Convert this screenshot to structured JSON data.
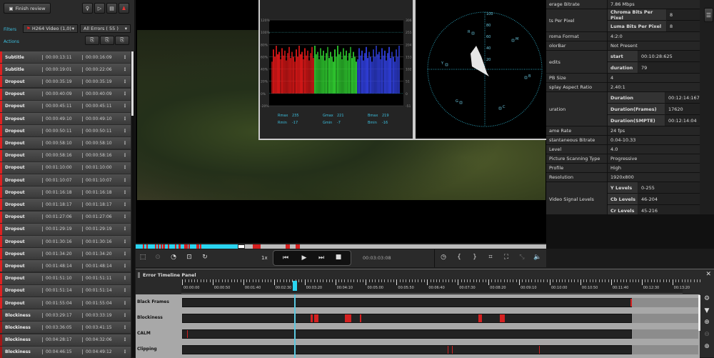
{
  "left_panel": {
    "finish_review_label": "Finish review",
    "filters_label": "Filters",
    "actions_label": "Actions",
    "track_select": "H264 Video (1,0)",
    "error_select": "All Errors ( 55 )",
    "icons": [
      "lightbulb-icon",
      "export-icon",
      "report-icon",
      "user-alert-icon"
    ],
    "errors": [
      {
        "type": "Subtitle",
        "start": "00:00:13:11",
        "end": "00:00:16:09"
      },
      {
        "type": "Subtitle",
        "start": "00:00:19:01",
        "end": "00:00:22:06"
      },
      {
        "type": "Dropout",
        "start": "00:00:35:19",
        "end": "00:00:35:19"
      },
      {
        "type": "Dropout",
        "start": "00:00:40:09",
        "end": "00:00:40:09"
      },
      {
        "type": "Dropout",
        "start": "00:00:45:11",
        "end": "00:00:45:11"
      },
      {
        "type": "Dropout",
        "start": "00:00:49:10",
        "end": "00:00:49:10"
      },
      {
        "type": "Dropout",
        "start": "00:00:50:11",
        "end": "00:00:50:11"
      },
      {
        "type": "Dropout",
        "start": "00:00:58:10",
        "end": "00:00:58:10"
      },
      {
        "type": "Dropout",
        "start": "00:00:58:16",
        "end": "00:00:58:16"
      },
      {
        "type": "Dropout",
        "start": "00:01:10:00",
        "end": "00:01:10:00"
      },
      {
        "type": "Dropout",
        "start": "00:01:10:07",
        "end": "00:01:10:07"
      },
      {
        "type": "Dropout",
        "start": "00:01:16:18",
        "end": "00:01:16:18"
      },
      {
        "type": "Dropout",
        "start": "00:01:18:17",
        "end": "00:01:18:17"
      },
      {
        "type": "Dropout",
        "start": "00:01:27:06",
        "end": "00:01:27:06"
      },
      {
        "type": "Dropout",
        "start": "00:01:29:19",
        "end": "00:01:29:19"
      },
      {
        "type": "Dropout",
        "start": "00:01:30:16",
        "end": "00:01:30:16"
      },
      {
        "type": "Dropout",
        "start": "00:01:34:20",
        "end": "00:01:34:20"
      },
      {
        "type": "Dropout",
        "start": "00:01:48:14",
        "end": "00:01:48:14"
      },
      {
        "type": "Dropout",
        "start": "00:01:51:10",
        "end": "00:01:51:11"
      },
      {
        "type": "Dropout",
        "start": "00:01:51:14",
        "end": "00:01:51:14"
      },
      {
        "type": "Dropout",
        "start": "00:01:55:04",
        "end": "00:01:55:04"
      },
      {
        "type": "Blockiness",
        "start": "00:03:29:17",
        "end": "00:03:33:19"
      },
      {
        "type": "Blockiness",
        "start": "00:03:36:05",
        "end": "00:03:41:15"
      },
      {
        "type": "Blockiness",
        "start": "00:04:28:17",
        "end": "00:04:32:06"
      },
      {
        "type": "Blockiness",
        "start": "00:04:46:15",
        "end": "00:04:49:12"
      }
    ]
  },
  "histogram": {
    "left_ticks": [
      "120%",
      "100%",
      "80%",
      "60%",
      "40%",
      "20%",
      "0%",
      "-20%"
    ],
    "right_ticks": [
      "306",
      "255",
      "204",
      "153",
      "102",
      "51",
      "0",
      "-51"
    ],
    "readouts": [
      {
        "label": "Rmax",
        "value": "235"
      },
      {
        "label": "Gmax",
        "value": "221"
      },
      {
        "label": "Bmax",
        "value": "219"
      },
      {
        "label": "Rmin",
        "value": "-17"
      },
      {
        "label": "Gmin",
        "value": "-7"
      },
      {
        "label": "Bmin",
        "value": "-16"
      }
    ]
  },
  "vectorscope": {
    "ticks": [
      "100",
      "80",
      "60",
      "40",
      "20"
    ],
    "targets": [
      "R",
      "M",
      "Y",
      "B",
      "G",
      "C"
    ]
  },
  "properties": [
    {
      "key": "erage Bitrate",
      "value": "7.86 Mbps"
    },
    {
      "key": "ts Per Pixel",
      "sub": [
        {
          "k": "Chroma Bits Per Pixel",
          "v": "8"
        },
        {
          "k": "Luma Bits Per Pixel",
          "v": "8"
        }
      ]
    },
    {
      "key": "roma Format",
      "value": "4:2:0"
    },
    {
      "key": "olorBar",
      "value": "Not Present"
    },
    {
      "key": "edits",
      "sub": [
        {
          "k": "start",
          "v": "00:10:28:625"
        },
        {
          "k": "duration",
          "v": "79"
        }
      ]
    },
    {
      "key": "PB Size",
      "value": "4"
    },
    {
      "key": "splay Aspect Ratio",
      "value": "2.40:1"
    },
    {
      "key": "uration",
      "sub": [
        {
          "k": "Duration",
          "v": "00:12:14:167"
        },
        {
          "k": "Duration(Frames)",
          "v": "17620"
        },
        {
          "k": "Duration(SMPTE)",
          "v": "00:12:14:04"
        }
      ]
    },
    {
      "key": "ame Rate",
      "value": "24 fps"
    },
    {
      "key": "stantaneous Bitrate",
      "value": "0.04-10.33"
    },
    {
      "key": "Level",
      "value": "4.0"
    },
    {
      "key": "Picture Scanning Type",
      "value": "Progressive"
    },
    {
      "key": "Profile",
      "value": "High"
    },
    {
      "key": "Resolution",
      "value": "1920x800"
    },
    {
      "key": "Video Signal Levels",
      "sub": [
        {
          "k": "Y Levels",
          "v": "0-255"
        },
        {
          "k": "Cb Levels",
          "v": "46-204"
        },
        {
          "k": "Cr Levels",
          "v": "45-216"
        }
      ]
    }
  ],
  "player": {
    "speed": "1x",
    "timecode": "00:03:03:08",
    "position": "00:03:03",
    "duration": "00:12:14",
    "played_color": "#2ad4f0",
    "error_color": "#d42020"
  },
  "timeline": {
    "title": "Error Timeline Panel",
    "ticks": [
      "00:00:00",
      "00:00:50",
      "00:01:40",
      "00:02:30",
      "00:03:20",
      "00:04:10",
      "00:05:00",
      "00:05:50",
      "00:06:40",
      "00:07:30",
      "00:08:20",
      "00:09:10",
      "00:10:00",
      "00:10:50",
      "00:11:40",
      "00:12:30",
      "00:13:20"
    ],
    "tracks": [
      {
        "name": "Black Frames",
        "events": [
          [
            "00:12:12",
            "00:12:14"
          ]
        ]
      },
      {
        "name": "Blockiness",
        "events": [
          [
            "00:03:30",
            "00:03:33"
          ],
          [
            "00:03:35",
            "00:03:42"
          ],
          [
            "00:04:26",
            "00:04:36"
          ],
          [
            "00:04:50",
            "00:04:52"
          ],
          [
            "00:08:03",
            "00:08:09"
          ],
          [
            "00:08:39",
            "00:08:47"
          ]
        ]
      },
      {
        "name": "CALM",
        "events": [
          [
            "00:00:08",
            "00:00:09"
          ]
        ]
      },
      {
        "name": "Clipping",
        "events": [
          [
            "00:07:13",
            "00:07:14"
          ],
          [
            "00:07:20",
            "00:07:22"
          ],
          [
            "00:09:42",
            "00:09:43"
          ]
        ]
      }
    ]
  }
}
